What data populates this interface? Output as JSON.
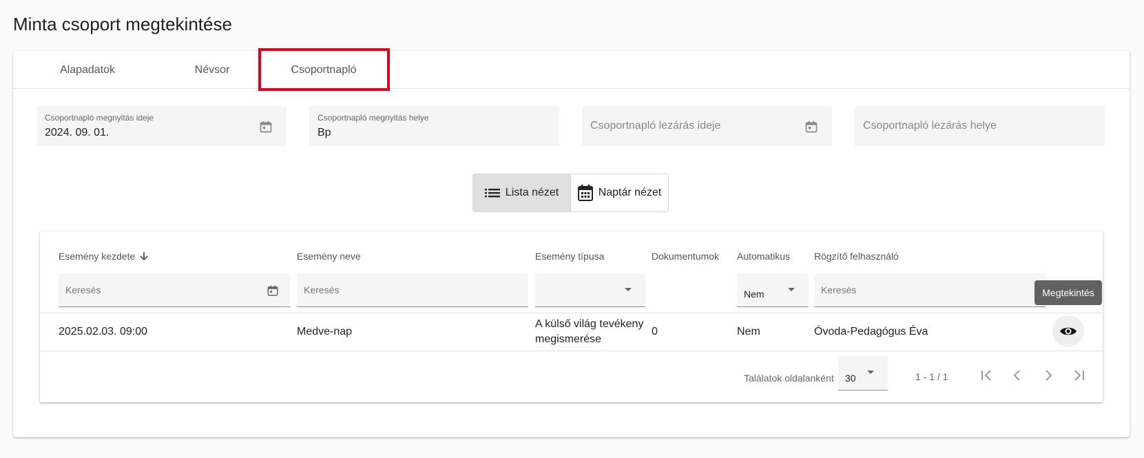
{
  "page": {
    "title": "Minta csoport megtekintése"
  },
  "tabs": [
    {
      "label": "Alapadatok"
    },
    {
      "label": "Névsor"
    },
    {
      "label": "Csoportnapló"
    }
  ],
  "fields": {
    "open_date": {
      "label": "Csoportnapló megnyitás ideje",
      "value": "2024. 09. 01."
    },
    "open_place": {
      "label": "Csoportnapló megnyitás helye",
      "value": "Bp"
    },
    "close_date": {
      "placeholder": "Csoportnapló lezárás ideje"
    },
    "close_place": {
      "placeholder": "Csoportnapló lezárás helye"
    }
  },
  "view_toggle": {
    "list": "Lista nézet",
    "calendar": "Naptár nézet"
  },
  "table": {
    "columns": [
      "Esemény kezdete",
      "Esemény neve",
      "Esemény típusa",
      "Dokumentumok",
      "Automatikus",
      "Rögzítő felhasználó"
    ],
    "filters": {
      "start_placeholder": "Keresés",
      "name_placeholder": "Keresés",
      "type_value": "",
      "auto_value": "Nem",
      "user_placeholder": "Keresés"
    },
    "rows": [
      {
        "start": "2025.02.03. 09:00",
        "name": "Medve-nap",
        "type": "A külső világ tevékeny megismerése",
        "docs": "0",
        "auto": "Nem",
        "user": "Óvoda-Pedagógus Éva"
      }
    ],
    "tooltip": "Megtekintés"
  },
  "pagination": {
    "per_page_label": "Találatok oldalanként",
    "page_size": "30",
    "range": "1 - 1 / 1"
  },
  "colors": {
    "highlight": "#e3001b",
    "tooltip_bg": "#616161"
  },
  "icons": [
    "calendar-icon",
    "list-icon",
    "calendar-month-icon",
    "arrow-down-icon",
    "eye-icon",
    "first-page-icon",
    "prev-page-icon",
    "next-page-icon",
    "last-page-icon"
  ]
}
